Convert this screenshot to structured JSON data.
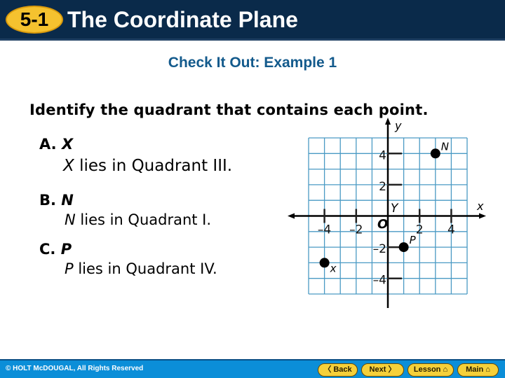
{
  "header": {
    "lesson_badge": "5-1",
    "title": "The Coordinate Plane"
  },
  "subtitle": "Check It Out: Example 1",
  "instruction": "Identify the quadrant that contains each point.",
  "items": [
    {
      "letter": "A.",
      "point": "X",
      "answer_point": "X",
      "answer_text": " lies in Quadrant III."
    },
    {
      "letter": "B.",
      "point": "N",
      "answer_point": "N",
      "answer_text": " lies in Quadrant I."
    },
    {
      "letter": "C.",
      "point": "P",
      "answer_point": "P",
      "answer_text": " lies in Quadrant IV."
    }
  ],
  "graph": {
    "x_axis_label": "x",
    "y_axis_label": "y",
    "origin_label": "O",
    "quadrant_marker": "Y",
    "range": [
      -5,
      5
    ],
    "x_ticks": [
      {
        "value": -4,
        "label": "–4"
      },
      {
        "value": -2,
        "label": "–2"
      },
      {
        "value": 2,
        "label": "2"
      },
      {
        "value": 4,
        "label": "4"
      }
    ],
    "y_ticks": [
      {
        "value": 4,
        "label": "4"
      },
      {
        "value": 2,
        "label": "2"
      },
      {
        "value": -2,
        "label": "–2"
      },
      {
        "value": -4,
        "label": "–4"
      }
    ],
    "points": [
      {
        "name": "X",
        "label": "x",
        "x": -4,
        "y": -3
      },
      {
        "name": "N",
        "label": "N",
        "x": 3,
        "y": 4
      },
      {
        "name": "P",
        "label": "P",
        "x": 1,
        "y": -2
      }
    ],
    "grid_color": "#4a9ac4",
    "axis_color": "#000000"
  },
  "footer": {
    "copyright": "© HOLT McDOUGAL, All Rights Reserved",
    "buttons": [
      {
        "label": "〈 Back",
        "name": "back"
      },
      {
        "label": "Next 〉",
        "name": "next"
      },
      {
        "label": "Lesson ⌂",
        "name": "lesson"
      },
      {
        "label": "Main ⌂",
        "name": "main"
      }
    ]
  }
}
